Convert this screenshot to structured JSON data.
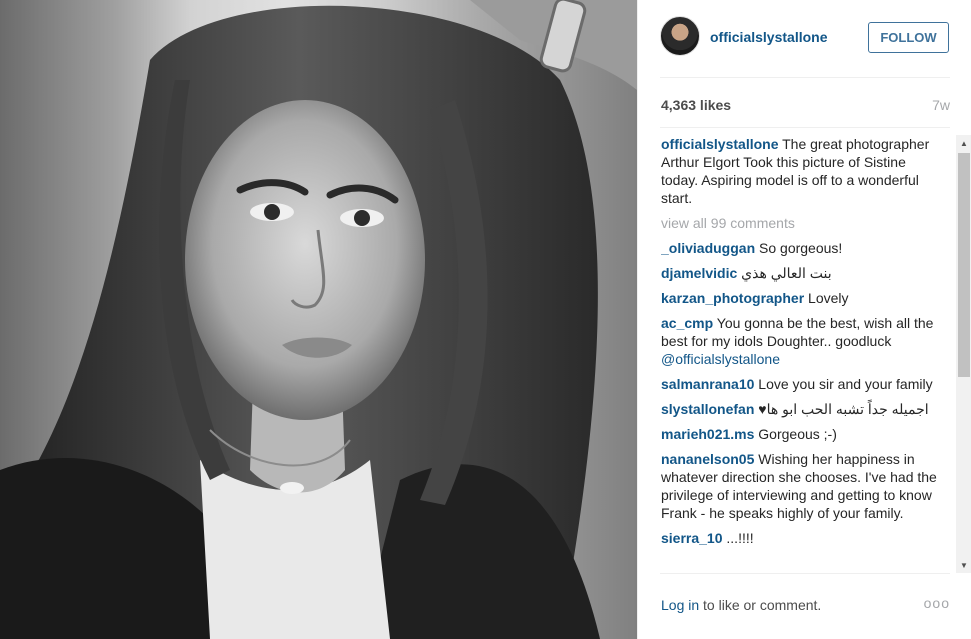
{
  "post": {
    "username": "officialslystallone",
    "follow_label": "FOLLOW",
    "likes": "4,363 likes",
    "time": "7w",
    "caption": "The great photographer Arthur Elgort Took this picture of Sistine today. Aspiring model is off to a wonderful start.",
    "view_all": "view all 99 comments",
    "login_link": "Log in",
    "login_rest": " to like or comment.",
    "more": "ooo"
  },
  "comments": [
    {
      "user": "_oliviaduggan",
      "text": " So gorgeous!"
    },
    {
      "user": "djamelvidic",
      "text": " بنت العالي هذي"
    },
    {
      "user": "karzan_photographer",
      "text": " Lovely"
    },
    {
      "user": "ac_cmp",
      "text": " You gonna be the best, wish all the best for my idols Doughter.. goodluck ",
      "mention": "@officialslystallone"
    },
    {
      "user": "salmanrana10",
      "text": " Love you sir and your family"
    },
    {
      "user": "slystallonefan",
      "text": " ♥اجميله جداً تشبه الحب ابو ها"
    },
    {
      "user": "marieh021.ms",
      "text": " Gorgeous ;-)"
    },
    {
      "user": "nananelson05",
      "text": " Wishing her happiness in whatever direction she chooses. I've had the privilege of interviewing and getting to know Frank - he speaks highly of your family."
    },
    {
      "user": "sierra_10",
      "text": " ...!!!!"
    }
  ]
}
